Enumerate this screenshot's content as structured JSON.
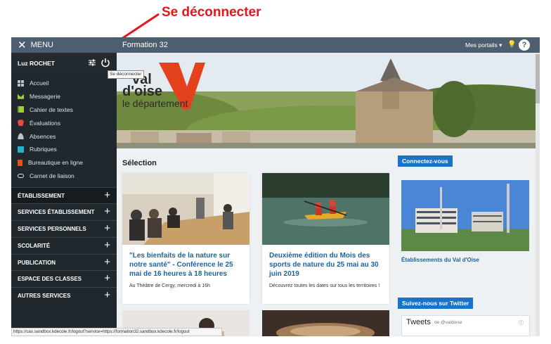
{
  "annotation": {
    "label": "Se déconnecter"
  },
  "topbar": {
    "menu_label": "MENU",
    "site_title": "Formation 32",
    "portals_label": "Mes portails ▾",
    "help_label": "?"
  },
  "user": {
    "name": "Luz ROCHET",
    "logout_tooltip": "Se déconnecter"
  },
  "nav": [
    {
      "label": "Accueil",
      "icon": "grid-icon",
      "color": "#b9c3cb"
    },
    {
      "label": "Messagerie",
      "icon": "envelope-icon",
      "color": "#9fcf36"
    },
    {
      "label": "Cahier de textes",
      "icon": "book-icon",
      "color": "#9fcf36"
    },
    {
      "label": "Évaluations",
      "icon": "evaluation-icon",
      "color": "#e64a3a"
    },
    {
      "label": "Absences",
      "icon": "person-icon",
      "color": "#b9c3cb"
    },
    {
      "label": "Rubriques",
      "icon": "folder-icon",
      "color": "#27b3c4"
    },
    {
      "label": "Bureautique en ligne",
      "icon": "office-icon",
      "color": "#e2541f"
    },
    {
      "label": "Carnet de liaison",
      "icon": "link-icon",
      "color": "#d9e3ea"
    }
  ],
  "sections": [
    {
      "label": "ÉTABLISSEMENT"
    },
    {
      "label": "SERVICES ÉTABLISSEMENT"
    },
    {
      "label": "SERVICES PERSONNELS"
    },
    {
      "label": "SCOLARITÉ"
    },
    {
      "label": "PUBLICATION"
    },
    {
      "label": "ESPACE DES CLASSES"
    },
    {
      "label": "AUTRES SERVICES"
    }
  ],
  "banner": {
    "logo_line1": "val",
    "logo_line2": "d'oise",
    "logo_line3": "le département"
  },
  "selection": {
    "title": "Sélection",
    "cards": [
      {
        "title": "\"Les bienfaits de la nature sur notre santé\" - Conférence le 25 mai de 16 heures à 18 heures",
        "desc": "Au Théâtre de Cergy, mercredi à 16h"
      },
      {
        "title": "Deuxième édition du Mois des sports de nature du 25 mai au 30 juin 2019",
        "desc": "Découvrez toutes les dates sur tous les territoires !"
      }
    ]
  },
  "right": {
    "connect_label": "Connectez-vous",
    "etab_link": "Établissements du Val d'Oise",
    "twitter_label": "Suivez-nous sur Twitter",
    "tweets_title": "Tweets",
    "tweets_by": "de @valdoise",
    "tweets_info": "ⓘ"
  },
  "status_url": "https://cas.sandbox.kdecole.fr/logout?service=https://formation32.sandbox.kdecole.fr/logout",
  "colors": {
    "topbar": "#4d5f6e",
    "sidebar": "#20272d",
    "accent": "#1a73c8",
    "annotation": "#e8141d",
    "logo": "#e3421d"
  }
}
